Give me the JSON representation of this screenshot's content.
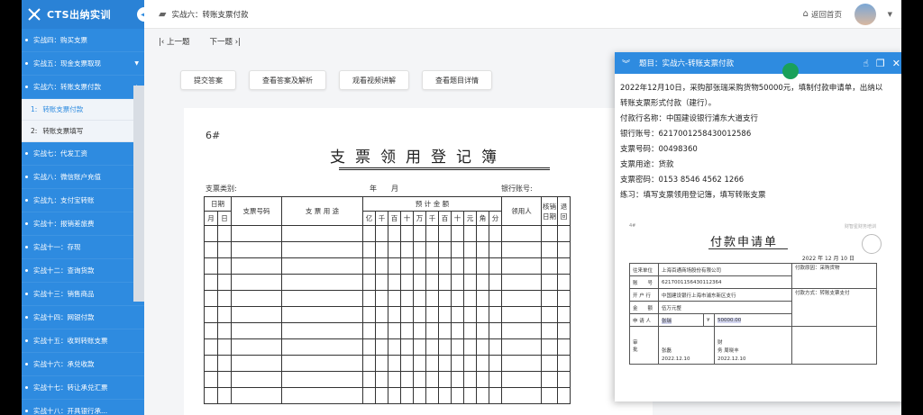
{
  "app": {
    "title": "CTS出纳实训"
  },
  "sidebar": {
    "items": [
      {
        "label": "实战四：购买支票",
        "caret": ""
      },
      {
        "label": "实战五：现金支票取现",
        "caret": "▼"
      },
      {
        "label": "实战六：转账支票付款",
        "caret": "▲"
      }
    ],
    "subitems": [
      {
        "num": "1:",
        "label": "转账支票付款"
      },
      {
        "num": "2:",
        "label": "转账支票填写"
      }
    ],
    "items_after": [
      {
        "label": "实战七：代发工资"
      },
      {
        "label": "实战八：微信账户充值"
      },
      {
        "label": "实战九：支付宝转账"
      },
      {
        "label": "实战十：报销差旅费"
      },
      {
        "label": "实战十一：存现"
      },
      {
        "label": "实战十二：查询货款"
      },
      {
        "label": "实战十三：销售商品"
      },
      {
        "label": "实战十四：网银付款"
      },
      {
        "label": "实战十五：收到转账支票"
      },
      {
        "label": "实战十六：承兑收款"
      },
      {
        "label": "实战十七：转让承兑汇票"
      },
      {
        "label": "实战十八：开具银行承..."
      }
    ]
  },
  "header": {
    "breadcrumb": "实战六：转账支票付款",
    "home": "返回首页"
  },
  "pager": {
    "prev": "上一题",
    "next": "下一题"
  },
  "actions": [
    "提交答案",
    "查看答案及解析",
    "观看视频讲解",
    "查看题目详情"
  ],
  "document": {
    "number": "6#",
    "title": "支票领用登记簿",
    "type_label": "支票类别:",
    "year_month": "年　　月",
    "bank_account": "银行账号:",
    "columns": {
      "date": "日期",
      "month": "月",
      "day": "日",
      "cheque_no": "支票号码",
      "usage": "支 票 用 途",
      "amount": "预 计 金 额",
      "digits": [
        "亿",
        "千",
        "百",
        "十",
        "万",
        "千",
        "百",
        "十",
        "元",
        "角",
        "分"
      ],
      "recipient": "领用人",
      "verify": "核销日期",
      "ret": "退回"
    }
  },
  "panel": {
    "title": "题目：实战六-转账支票付款",
    "lines": [
      "2022年12月10日，采购部张瑞采购货物50000元，填制付款申请单，出纳以",
      "转账支票形式付款（建行）。",
      "付款行名称：中国建设银行浦东大道支行",
      "银行账号：6217001258430012586",
      "支票号码：00498360",
      "支票用途：货款",
      "支票密码：0153 8546 4562 1266",
      "练习：填写支票领用登记簿，填写转账支票"
    ],
    "form": {
      "top_label": "4#",
      "watermark": "财智星财务培训",
      "title": "付款申请单",
      "date": "2022 年  12 月  10 日",
      "rows": [
        {
          "label": "往来单位",
          "value": "上海百通商场股份有限公司"
        },
        {
          "label": "账　　号",
          "value": "6217001156430112364"
        },
        {
          "label": "开 户 行",
          "value": "中国建设银行上海市浦东新区支行"
        },
        {
          "label": "金　　额",
          "value": "伍万元整"
        }
      ],
      "reason": "付款原因：采购货物",
      "method": "付款方式：转账支票支付",
      "applicant_label": "申 请 人",
      "applicant": "张瑞",
      "amount": "¥",
      "amount_value": "50000.00",
      "approve": "审\n批",
      "approver": "张磊",
      "approve_date": "2022.12.10",
      "finance": "财\n务",
      "financer": "周晓丰",
      "finance_date": "2022.12.10"
    }
  }
}
